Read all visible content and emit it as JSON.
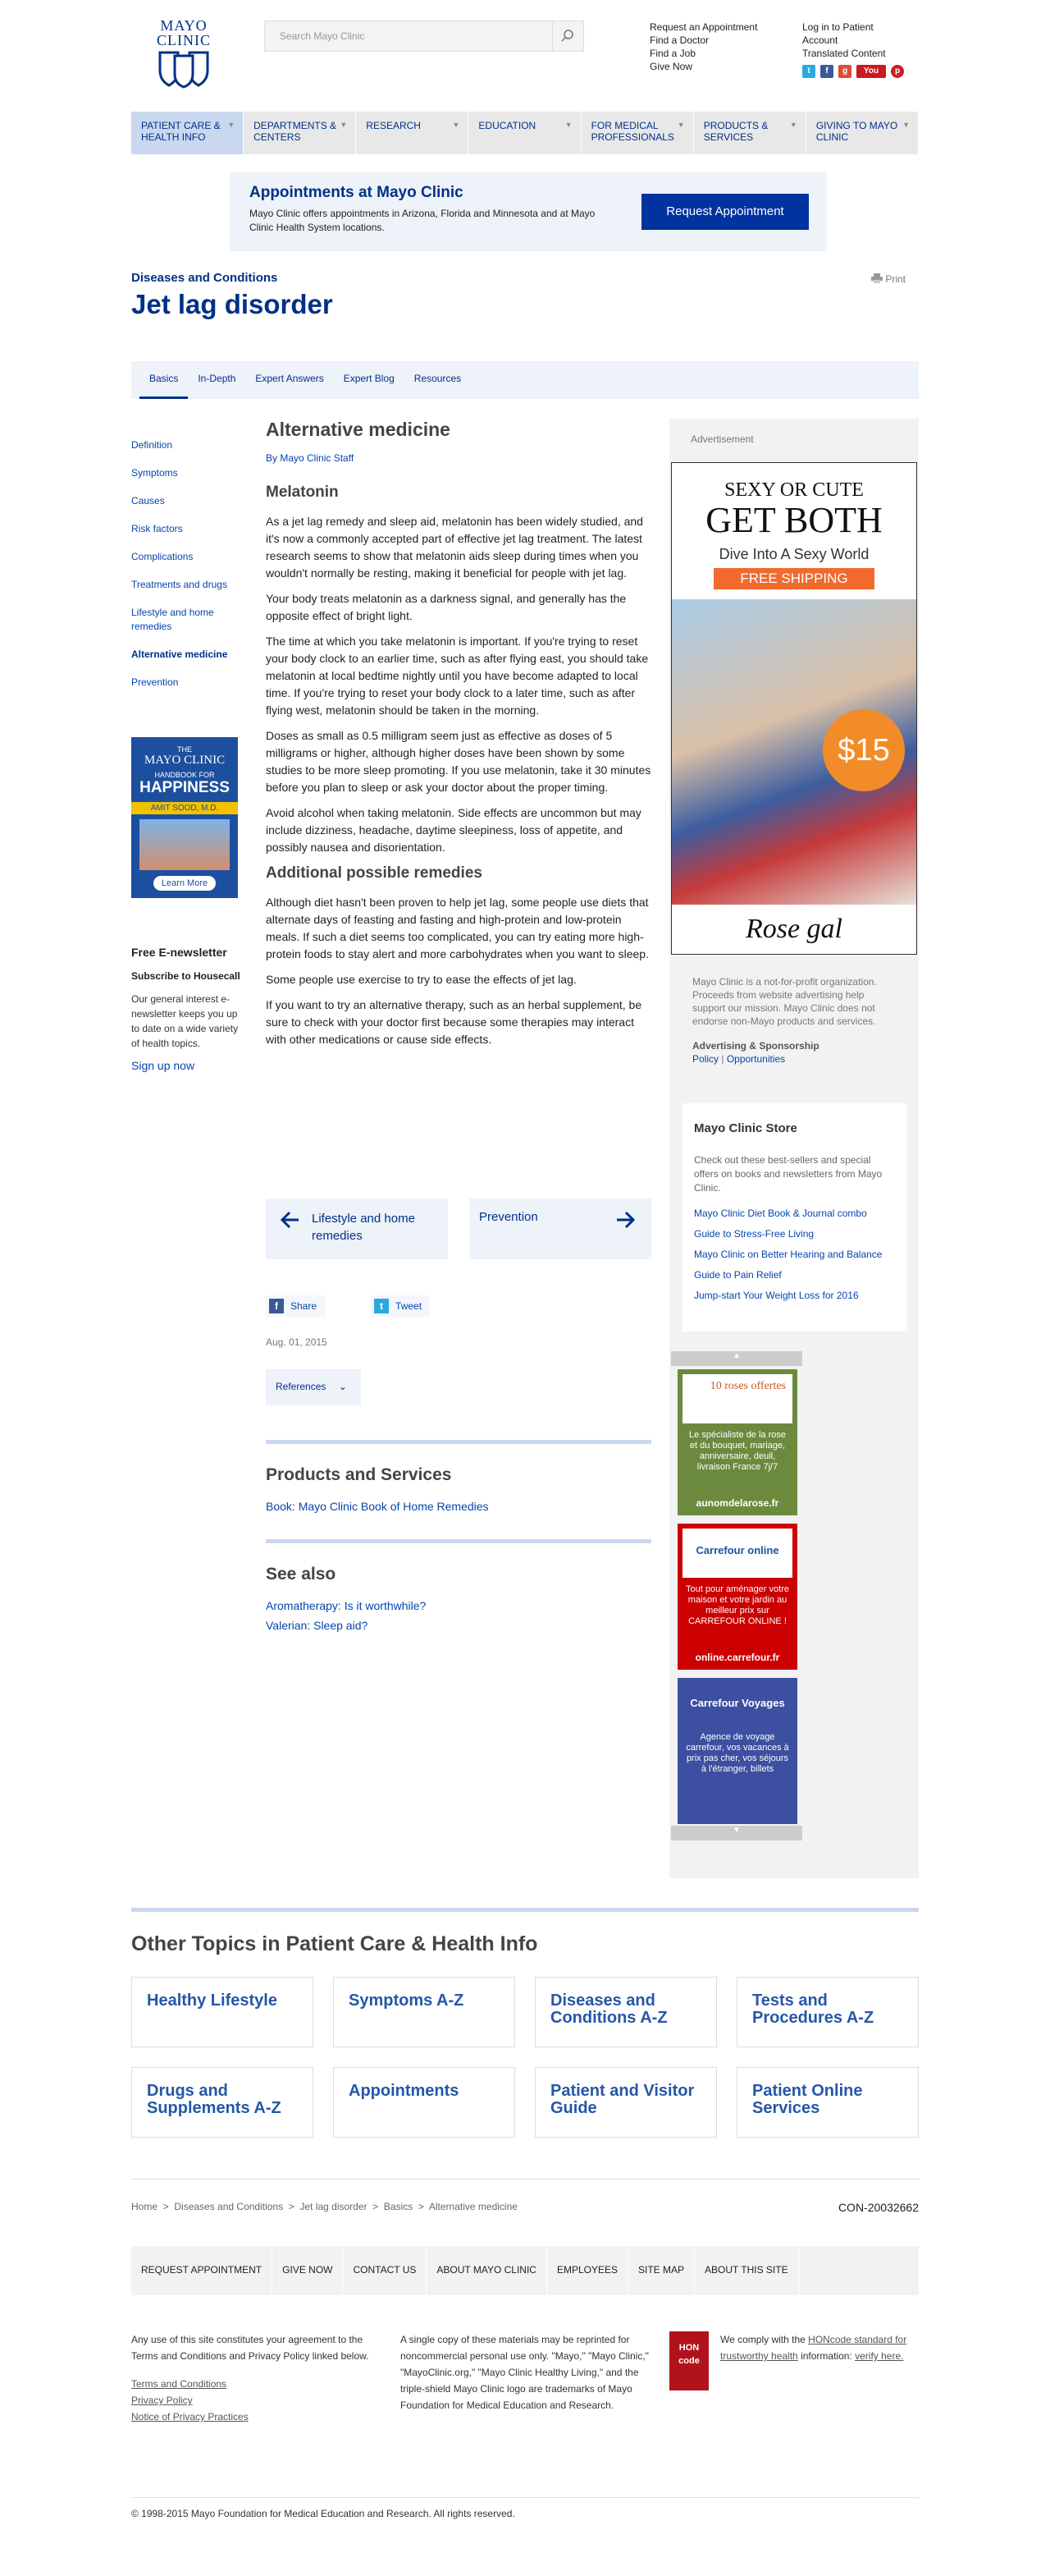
{
  "header": {
    "logo_line1": "MAYO",
    "logo_line2": "CLINIC",
    "search_placeholder": "Search Mayo Clinic",
    "links_left": [
      "Request an Appointment",
      "Find a Doctor",
      "Find a Job",
      "Give Now"
    ],
    "links_right": [
      "Log in to Patient",
      "Account",
      "Translated Content"
    ],
    "socials": [
      "twitter-icon",
      "facebook-icon",
      "google-plus-icon",
      "youtube-icon",
      "pinterest-icon"
    ]
  },
  "nav": [
    {
      "label": "PATIENT CARE & HEALTH INFO"
    },
    {
      "label": "DEPARTMENTS & CENTERS"
    },
    {
      "label": "RESEARCH"
    },
    {
      "label": "EDUCATION"
    },
    {
      "label": "FOR MEDICAL PROFESSIONALS"
    },
    {
      "label": "PRODUCTS & SERVICES"
    },
    {
      "label": "GIVING TO MAYO CLINIC"
    }
  ],
  "appointments": {
    "heading": "Appointments at Mayo Clinic",
    "text": "Mayo Clinic offers appointments in Arizona, Florida and Minnesota and at Mayo Clinic Health System locations.",
    "button": "Request Appointment"
  },
  "page": {
    "section": "Diseases and Conditions",
    "title": "Jet lag disorder",
    "print": "Print"
  },
  "tabs": [
    "Basics",
    "In-Depth",
    "Expert Answers",
    "Expert Blog",
    "Resources"
  ],
  "left_nav": [
    "Definition",
    "Symptoms",
    "Causes",
    "Risk factors",
    "Complications",
    "Treatments and drugs",
    "Lifestyle and home remedies",
    "Alternative medicine",
    "Prevention"
  ],
  "book_ad": {
    "line1": "THE",
    "line2": "MAYO CLINIC",
    "line3": "HANDBOOK FOR",
    "line4": "HAPPINESS",
    "line5": "AMIT SOOD, M.D.",
    "button": "Learn More"
  },
  "enews": {
    "title": "Free E-newsletter",
    "subtitle": "Subscribe to Housecall",
    "text": "Our general interest e-newsletter keeps you up to date on a wide variety of health topics.",
    "link": "Sign up now"
  },
  "article": {
    "title": "Alternative medicine",
    "byline": "By Mayo Clinic Staff",
    "h_melatonin": "Melatonin",
    "p1": "As a jet lag remedy and sleep aid, melatonin has been widely studied, and it's now a commonly accepted part of effective jet lag treatment. The latest research seems to show that melatonin aids sleep during times when you wouldn't normally be resting, making it beneficial for people with jet lag.",
    "p2": "Your body treats melatonin as a darkness signal, and generally has the opposite effect of bright light.",
    "p3": "The time at which you take melatonin is important. If you're trying to reset your body clock to an earlier time, such as after flying east, you should take melatonin at local bedtime nightly until you have become adapted to local time. If you're trying to reset your body clock to a later time, such as after flying west, melatonin should be taken in the morning.",
    "p4": "Doses as small as 0.5 milligram seem just as effective as doses of 5 milligrams or higher, although higher doses have been shown by some studies to be more sleep promoting. If you use melatonin, take it 30 minutes before you plan to sleep or ask your doctor about the proper timing.",
    "p5": "Avoid alcohol when taking melatonin. Side effects are uncommon but may include dizziness, headache, daytime sleepiness, loss of appetite, and possibly nausea and disorientation.",
    "h_additional": "Additional possible remedies",
    "p6": "Although diet hasn't been proven to help jet lag, some people use diets that alternate days of feasting and fasting and high-protein and low-protein meals. If such a diet seems too complicated, you can try eating more high-protein foods to stay alert and more carbohydrates when you want to sleep.",
    "p7": "Some people use exercise to try to ease the effects of jet lag.",
    "p8": "If you want to try an alternative therapy, such as an herbal supplement, be sure to check with your doctor first because some therapies may interact with other medications or cause side effects.",
    "prev": "Lifestyle and home remedies",
    "next": "Prevention",
    "share": "Share",
    "tweet": "Tweet",
    "date": "Aug. 01, 2015",
    "references": "References"
  },
  "products": {
    "title": "Products and Services",
    "link": "Book: Mayo Clinic Book of Home Remedies"
  },
  "see_also": {
    "title": "See also",
    "links": [
      "Aromatherapy: Is it worthwhile?",
      "Valerian: Sleep aid?"
    ]
  },
  "rail": {
    "ad_label": "Advertisement",
    "ad": {
      "line1": "SEXY OR CUTE",
      "line2": "GET BOTH",
      "line3": "Dive Into A Sexy World",
      "line4": "FREE SHIPPING",
      "price": "$15",
      "brand": "Rose gal"
    },
    "nonprofit": "Mayo Clinic is a not-for-profit organization. Proceeds from website advertising help support our mission. Mayo Clinic does not endorse non-Mayo products and services.",
    "adv_title": "Advertising & Sponsorship",
    "adv_links": [
      "Policy",
      "Opportunities"
    ],
    "store": {
      "title": "Mayo Clinic Store",
      "text": "Check out these best-sellers and special offers on books and newsletters from Mayo Clinic.",
      "links": [
        "Mayo Clinic Diet Book & Journal combo",
        "Guide to Stress-Free Living",
        "Mayo Clinic on Better Hearing and Balance",
        "Guide to Pain Relief",
        "Jump-start Your Weight Loss for 2016"
      ]
    },
    "carousel": [
      {
        "head": "10 roses offertes",
        "body": "Le spécialiste de la rose et du bouquet, mariage, anniversaire, deuil, livraison France 7j/7",
        "site": "aunomdelarose.fr",
        "color": "#6b8a3e"
      },
      {
        "head": "Carrefour online",
        "body": "Tout pour aménager votre maison et votre jardin au meilleur prix sur CARREFOUR ONLINE !",
        "site": "online.carrefour.fr",
        "color": "#cc0000"
      },
      {
        "head": "Carrefour Voyages",
        "body": "Agence de voyage carrefour, vos vacances à prix pas cher, vos séjours à l'étranger, billets",
        "site": "",
        "color": "#3c4fa0"
      }
    ]
  },
  "other_topics": {
    "title": "Other Topics in Patient Care & Health Info",
    "tiles": [
      "Healthy Lifestyle",
      "Symptoms A-Z",
      "Diseases and Conditions A-Z",
      "Tests and Procedures A-Z",
      "Drugs and Supplements A-Z",
      "Appointments",
      "Patient and Visitor Guide",
      "Patient Online Services"
    ]
  },
  "footer": {
    "breadcrumb": [
      "Home",
      "Diseases and Conditions",
      "Jet lag disorder",
      "Basics",
      "Alternative medicine"
    ],
    "code": "CON-20032662",
    "links": [
      "REQUEST APPOINTMENT",
      "GIVE NOW",
      "CONTACT US",
      "ABOUT MAYO CLINIC",
      "EMPLOYEES",
      "SITE MAP",
      "ABOUT THIS SITE"
    ],
    "col1": "Any use of this site constitutes your agreement to the Terms and Conditions and Privacy Policy linked below.",
    "col1_links": [
      "Terms and Conditions",
      "Privacy Policy",
      "Notice of Privacy Practices"
    ],
    "col2": "A single copy of these materials may be reprinted for noncommercial personal use only. \"Mayo,\" \"Mayo Clinic,\" \"MayoClinic.org,\" \"Mayo Clinic Healthy Living,\" and the triple-shield Mayo Clinic logo are trademarks of Mayo Foundation for Medical Education and Research.",
    "hon_pre": "We comply with the",
    "hon_link": "HONcode standard for trustworthy health",
    "hon_mid": "information:",
    "hon_verify": "verify here.",
    "hon_badge": "HON code",
    "copyright": "© 1998-2015 Mayo Foundation for Medical Education and Research. All rights reserved."
  }
}
